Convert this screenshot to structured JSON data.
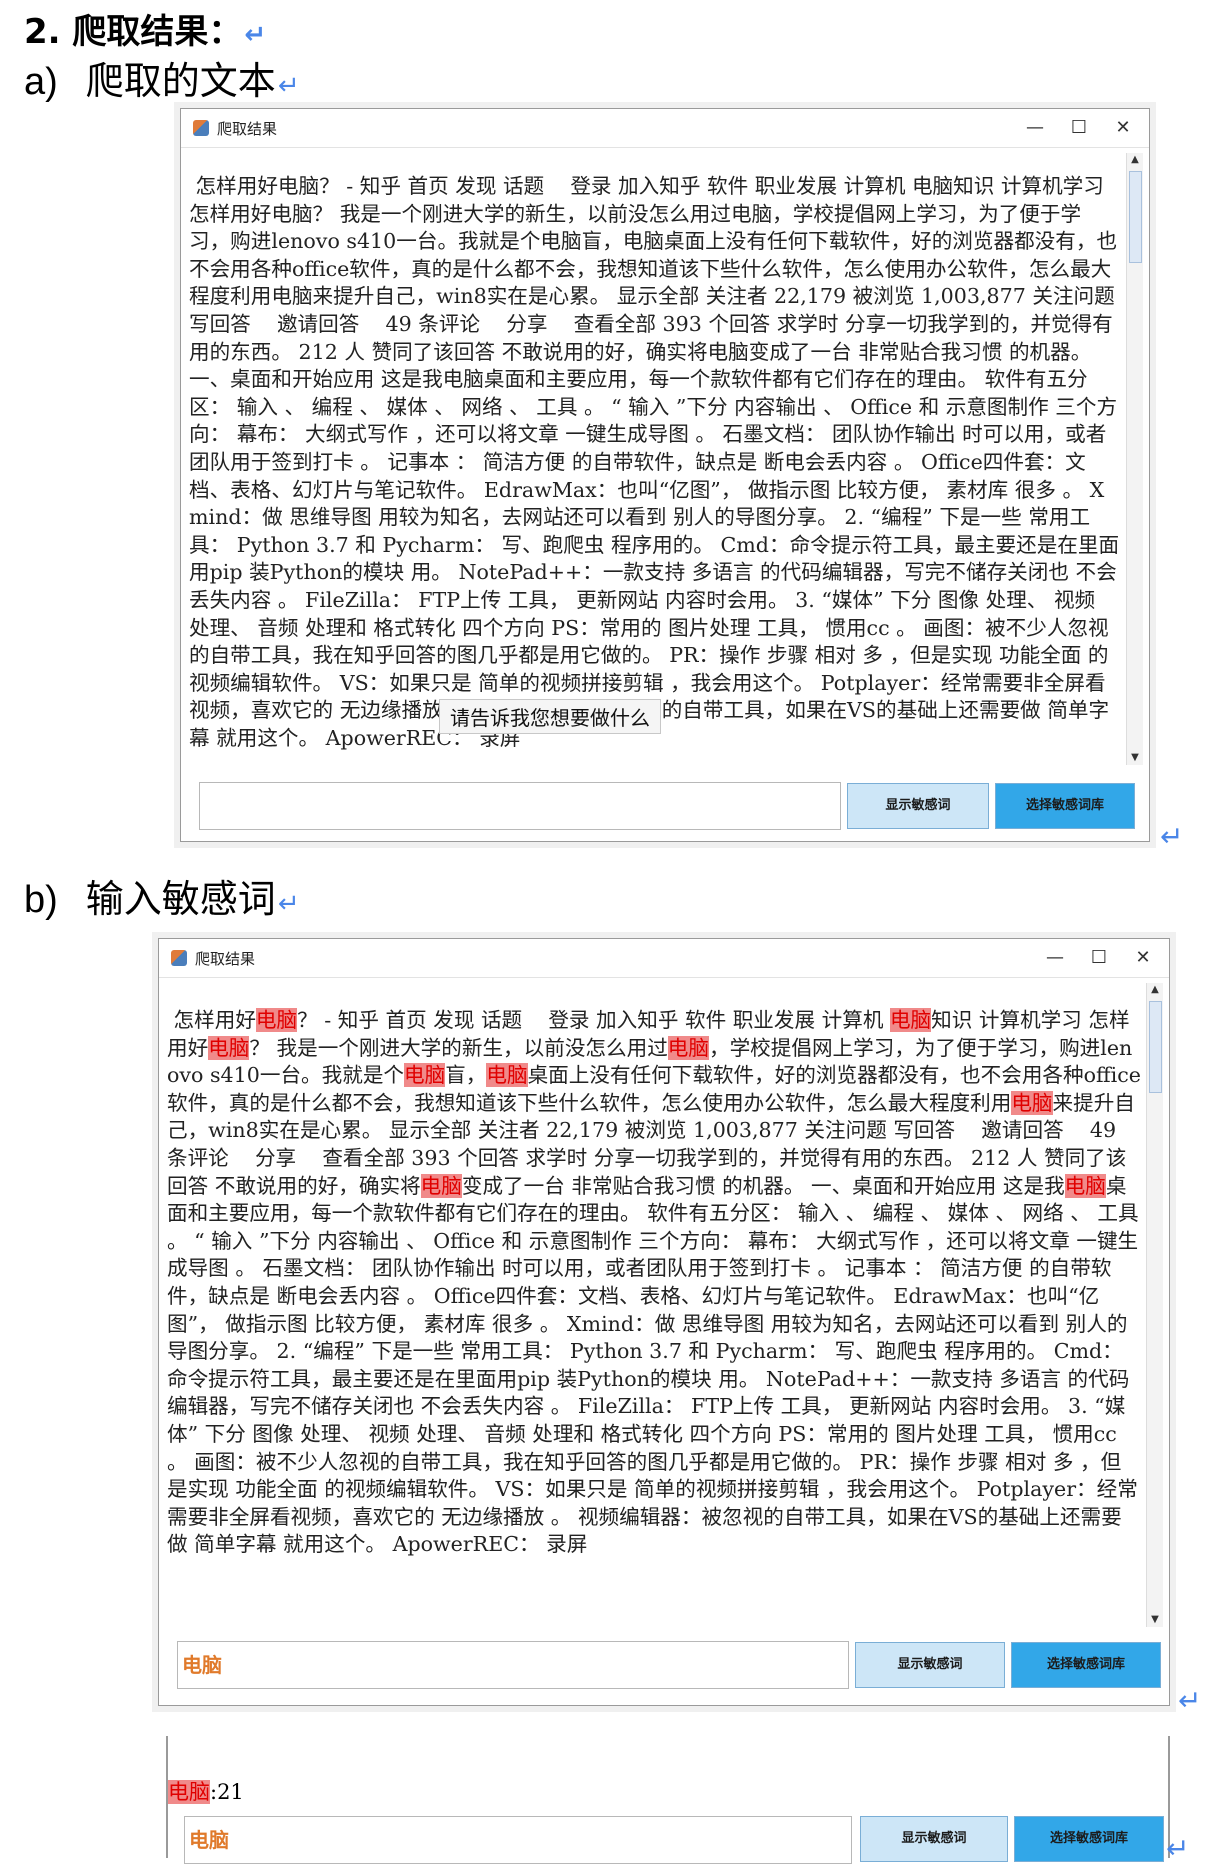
{
  "doc": {
    "heading": "2. 爬取结果：",
    "section_a": {
      "label": "a)",
      "text": "爬取的文本"
    },
    "section_b": {
      "label": "b)",
      "text": "输入敏感词"
    },
    "return_mark": "↵",
    "return_mark_big": "↵"
  },
  "window1": {
    "title": "爬取结果",
    "controls": {
      "minimize": "—",
      "maximize": "☐",
      "close": "✕"
    },
    "tooltip": "请告诉我您想要做什么",
    "input_value": "",
    "btn_show": "显示敏感词",
    "btn_select": "选择敏感词库"
  },
  "window2": {
    "title": "爬取结果",
    "controls": {
      "minimize": "—",
      "maximize": "☐",
      "close": "✕"
    },
    "input_value": "电脑",
    "btn_show": "显示敏感词",
    "btn_select": "选择敏感词库",
    "highlight_word": "电脑"
  },
  "result_strip": {
    "count_word": "电脑",
    "count_text": ":21",
    "input_value": "电脑",
    "btn_show": "显示敏感词",
    "btn_select": "选择敏感词库"
  },
  "crawled_text": " 怎样用好电脑？ - 知乎 首页 发现 话题    登录 加入知乎 软件 职业发展 计算机 电脑知识 计算机学习 怎样用好电脑？ 我是一个刚进大学的新生，以前没怎么用过电脑，学校提倡网上学习，为了便于学习，购进lenovo s410一台。我就是个电脑盲，电脑桌面上没有任何下载软件，好的浏览器都没有，也不会用各种office软件，真的是什么都不会，我想知道该下些什么软件，怎么使用办公软件，怎么最大程度利用电脑来提升自己，win8实在是心累。 显示全部 关注者 22,179 被浏览 1,003,877 关注问题 写回答    邀请回答    49 条评论    分享    查看全部 393 个回答 求学时 分享一切我学到的，并觉得有用的东西。 212 人 赞同了该回答 不敢说用的好，确实将电脑变成了一台 非常贴合我习惯 的机器。 一、桌面和开始应用 这是我电脑桌面和主要应用，每一个款软件都有它们存在的理由。 软件有五分区： 输入 、 编程 、 媒体 、 网络 、 工具 。 “ 输入 ”下分 内容输出 、 Office 和 示意图制作 三个方向： 幕布： 大纲式写作 ，还可以将文章 一键生成导图 。 石墨文档： 团队协作输出 时可以用，或者团队用于签到打卡 。 记事本 ： 简洁方便 的自带软件，缺点是 断电会丢内容 。 Office四件套：文档、表格、幻灯片与笔记软件。 EdrawMax：也叫“亿图”， 做指示图 比较方便， 素材库 很多 。 Xmind：做 思维导图 用较为知名，去网站还可以看到 别人的导图分享。 2. “编程” 下是一些 常用工具： Python 3.7 和 Pycharm： 写、跑爬虫 程序用的。 Cmd：命令提示符工具，最主要还是在里面用pip 装Python的模块 用。 NotePad++：一款支持 多语言 的代码编辑器，写完不储存关闭也 不会丢失内容 。 FileZilla： FTP上传 工具， 更新网站 内容时会用。 3. “媒体” 下分 图像 处理、 视频 处理、 音频 处理和 格式转化 四个方向 PS：常用的 图片处理 工具， 惯用cc 。 画图：被不少人忽视的自带工具，我在知乎回答的图几乎都是用它做的。 PR：操作 步骤 相对 多 ，但是实现 功能全面 的视频编辑软件。 VS：如果只是 简单的视频拼接剪辑 ，我会用这个。 Potplayer：经常需要非全屏看视频，喜欢它的 无边缘播放 。 视频编辑器：被忽视的自带工具，如果在VS的基础上还需要做 简单字幕 就用这个。 ApowerREC： 录屏"
}
